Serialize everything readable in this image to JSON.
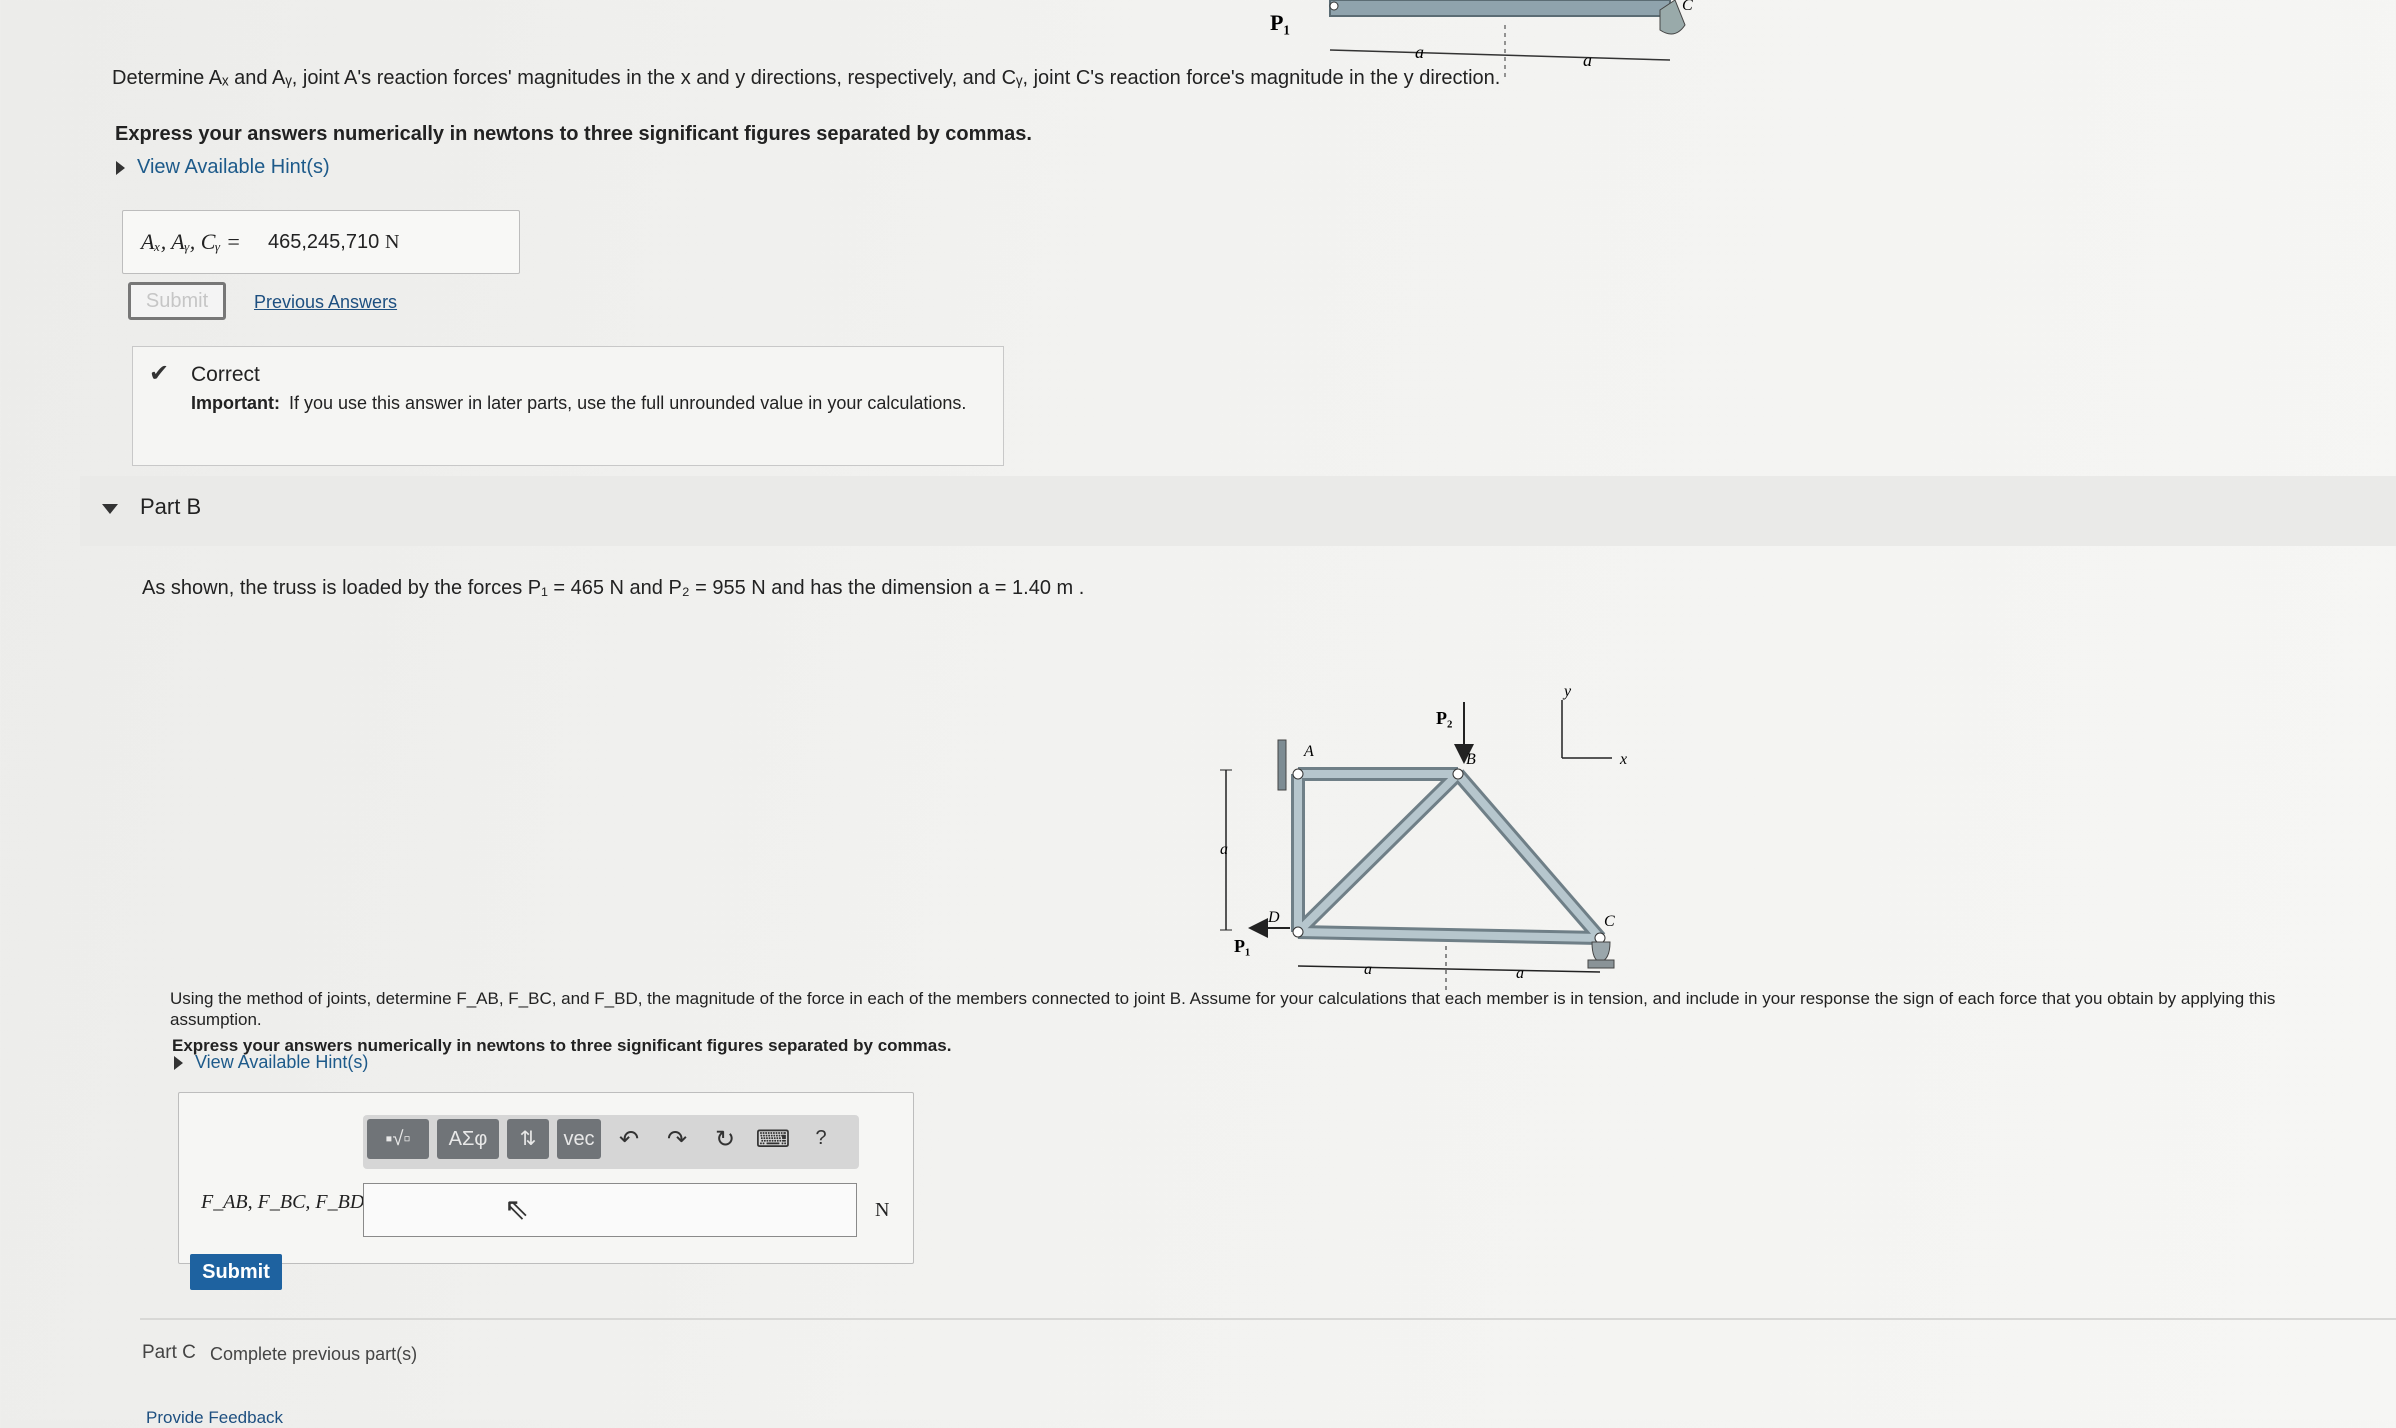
{
  "top_figure": {
    "p1_label": "P₁",
    "dim_a1": "a",
    "dim_a2": "a",
    "c_label": "C"
  },
  "part_a": {
    "question": "Determine Aₓ and Aᵧ, joint A's reaction forces' magnitudes in the x and y directions, respectively, and Cᵧ, joint C's reaction force's magnitude in the y direction.",
    "instruction": "Express your answers numerically in newtons to three significant figures separated by commas.",
    "hint_label": "View Available Hint(s)",
    "answer_label": "Aₓ, Aᵧ, Cᵧ =",
    "answer_value": "465,245,710",
    "answer_unit": "N",
    "submit_label": "Submit",
    "previous_answers_label": "Previous Answers",
    "correct_title": "Correct",
    "important_label": "Important:",
    "important_text": "If you use this answer in later parts, use the full unrounded value in your calculations."
  },
  "part_b": {
    "header": "Part B",
    "statement": "As shown, the truss is loaded by the forces P₁ = 465 N and P₂ = 955 N and has the dimension a = 1.40 m .",
    "question": "Using the method of joints, determine F_AB, F_BC, and F_BD, the magnitude of the force in each of the members connected to joint B. Assume for your calculations that each member is in tension, and include in your response the sign of each force that you obtain by applying this assumption.",
    "instruction": "Express your answers numerically in newtons to three significant figures separated by commas.",
    "hint_label": "View Available Hint(s)",
    "toolbar": [
      "▪√▫",
      "ΑΣφ",
      "⇅",
      "vec",
      "↶",
      "↷",
      "↻",
      "⌨",
      "?"
    ],
    "answer_label": "F_AB, F_BC, F_BD =",
    "answer_value": "",
    "answer_unit": "N",
    "submit_label": "Submit"
  },
  "figure": {
    "labels": {
      "A": "A",
      "B": "B",
      "C": "C",
      "D": "D",
      "P1": "P₁",
      "P2": "P₂",
      "x": "x",
      "y": "y",
      "a_vertical": "a",
      "a_left": "a",
      "a_right": "a"
    }
  },
  "part_c": {
    "label": "Part C",
    "status": "Complete previous part(s)"
  },
  "footer_cut": "Provide Feedback"
}
